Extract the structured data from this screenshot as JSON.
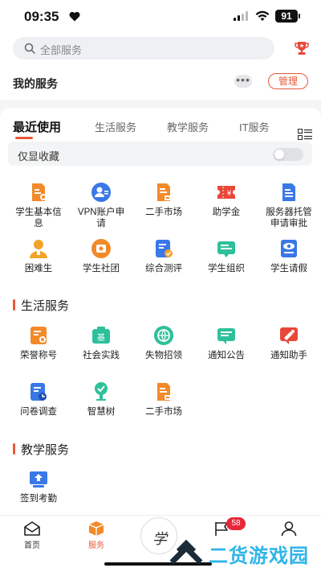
{
  "status": {
    "time": "09:35",
    "battery": "91"
  },
  "search": {
    "placeholder": "全部服务"
  },
  "my_services": {
    "title": "我的服务",
    "more": "•••",
    "manage": "管理"
  },
  "tabs": [
    "最近使用",
    "生活服务",
    "教学服务",
    "IT服务"
  ],
  "favorites_only": {
    "label": "仅显收藏",
    "on": false
  },
  "recent_apps": [
    {
      "label": "学生基本信息",
      "icon": "student-info-doc-icon",
      "color": "#f28a2a"
    },
    {
      "label": "VPN账户申请",
      "icon": "vpn-account-icon",
      "color": "#3a78e7"
    },
    {
      "label": "二手市场",
      "icon": "secondhand-market-icon",
      "color": "#f28a2a"
    },
    {
      "label": "助学金",
      "icon": "grant-ticket-icon",
      "color": "#e8483a"
    },
    {
      "label": "服务器托管申请审批",
      "icon": "server-hosting-doc-icon",
      "color": "#3a78e7"
    },
    {
      "label": "困难生",
      "icon": "needy-student-icon",
      "color": "#f2a32a"
    },
    {
      "label": "学生社团",
      "icon": "student-club-icon",
      "color": "#f28a2a"
    },
    {
      "label": "综合测评",
      "icon": "comprehensive-eval-icon",
      "color": "#3a78e7"
    },
    {
      "label": "学生组织",
      "icon": "student-org-icon",
      "color": "#2ec09a"
    },
    {
      "label": "学生请假",
      "icon": "student-leave-icon",
      "color": "#3a78e7"
    }
  ],
  "life_section": {
    "title": "生活服务"
  },
  "life_apps": [
    {
      "label": "荣誉称号",
      "icon": "honor-title-icon",
      "color": "#f28a2a"
    },
    {
      "label": "社会实践",
      "icon": "social-practice-icon",
      "color": "#2ec09a"
    },
    {
      "label": "失物招领",
      "icon": "lost-found-icon",
      "color": "#2ec09a"
    },
    {
      "label": "通知公告",
      "icon": "notice-icon",
      "color": "#2ec09a"
    },
    {
      "label": "通知助手",
      "icon": "notify-assistant-icon",
      "color": "#e8483a"
    },
    {
      "label": "问卷调查",
      "icon": "survey-icon",
      "color": "#3a78e7"
    },
    {
      "label": "智慧树",
      "icon": "smart-tree-icon",
      "color": "#2ec09a"
    },
    {
      "label": "二手市场",
      "icon": "secondhand-market-icon",
      "color": "#f28a2a"
    }
  ],
  "teach_section": {
    "title": "教学服务"
  },
  "teach_apps": [
    {
      "label": "签到考勤",
      "icon": "check-in-icon",
      "color": "#3a78e7"
    }
  ],
  "tabbar": {
    "home": "首页",
    "services": "服务",
    "center_logo": "学",
    "message_badge": "58"
  },
  "watermark": {
    "text": "二货游戏园"
  }
}
